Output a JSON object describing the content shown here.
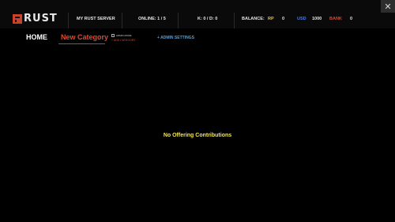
{
  "header": {
    "logo_text": "RUST",
    "server_name": "MY RUST SERVER",
    "online": "ONLINE: 1 / 5",
    "kd": "K: 0  / D: 0",
    "balance_label": "BALANCE:",
    "rp_label": "RP",
    "rp_value": "0",
    "usd_label": "USD",
    "usd_value": "1000",
    "bank_label": "BANK",
    "bank_value": "0",
    "close_symbol": "✕"
  },
  "nav": {
    "home": "HOME",
    "category": "New Category",
    "admin_mode": "ADMIN MODE",
    "add_category": "+ ADD CATEGORY",
    "admin_settings": "+ ADMIN SETTINGS"
  },
  "main": {
    "empty_message": "No Offering Contributions"
  },
  "colors": {
    "rp": "#e8c21c",
    "usd": "#4a7be0",
    "bank": "#e2472b",
    "accent": "#e2472b"
  }
}
